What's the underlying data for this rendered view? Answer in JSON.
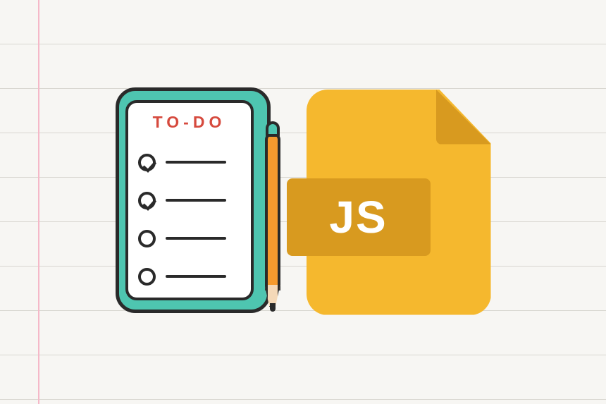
{
  "notepad": {
    "title": "TO-DO",
    "items": [
      {
        "checked": true
      },
      {
        "checked": true
      },
      {
        "checked": false
      },
      {
        "checked": false
      }
    ]
  },
  "jsfile": {
    "label": "JS"
  }
}
